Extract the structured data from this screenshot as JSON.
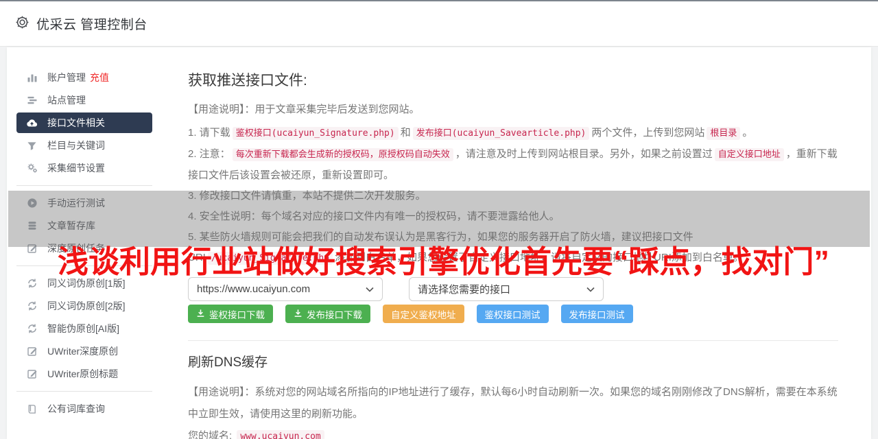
{
  "header": {
    "title": "优采云 管理控制台"
  },
  "sidebar": {
    "items": [
      {
        "label": "账户管理",
        "badge": "充值"
      },
      {
        "label": "站点管理"
      },
      {
        "label": "接口文件相关",
        "active": true
      },
      {
        "label": "栏目与关键词"
      },
      {
        "label": "采集细节设置"
      },
      {
        "label": "手动运行测试"
      },
      {
        "label": "文章暂存库"
      },
      {
        "label": "深度原创任务"
      },
      {
        "label": "同义词伪原创[1版]"
      },
      {
        "label": "同义词伪原创[2版]"
      },
      {
        "label": "智能伪原创[AI版]"
      },
      {
        "label": "UWriter深度原创"
      },
      {
        "label": "UWriter原创标题"
      },
      {
        "label": "公有词库查询"
      }
    ]
  },
  "guide": {
    "title": "获取推送接口文件:",
    "usage": "【用途说明】：用于文章采集完毕后发送到您网站。",
    "item1": {
      "a": "1. 请下载",
      "code1": "鉴权接口(ucaiyun_Signature.php)",
      "b": "和",
      "code2": "发布接口(ucaiyun_Savearticle.php)",
      "c": "两个文件，上传到您网站",
      "code3": "根目录",
      "d": "。"
    },
    "item2": {
      "a": "2. 注意：",
      "hl": "每次重新下载都会生成新的授权码，原授权码自动失效",
      "b": "，请注意及时上传到网站根目录。另外，如果之前设置过",
      "code": "自定义接口地址",
      "c": "，重新下载接口文件后该设置会被还原，重新设置即可。"
    },
    "item3": "3. 修改接口文件请慎重，本站不提供二次开发服务。",
    "item4": "4. 安全性说明：每个域名对应的接口文件内有唯一的授权码，请不要泄露给他人。",
    "item5": {
      "a": "5. 某些防火墙规则可能会把我们的自动发布误认为是黑客行为，如果您的服务器开启了防火墙，建议把接口文件URI",
      "code": "/ucaiyun_Signature.php",
      "b": "添加到白名单，如果您设置了自定义接口地址，请将自定义的接口地址URI添加到白名单。"
    }
  },
  "controls": {
    "site_select": "https://www.ucaiyun.com",
    "api_select": "请选择您需要的接口",
    "btn_auth_download": "鉴权接口下载",
    "btn_publish_download": "发布接口下载",
    "btn_custom_auth": "自定义鉴权地址",
    "btn_auth_test": "鉴权接口测试",
    "btn_publish_test": "发布接口测试"
  },
  "dns": {
    "title": "刷新DNS缓存",
    "usage": "【用途说明】：系统对您的网站域名所指向的IP地址进行了缓存，默认每6小时自动刷新一次。如果您的域名刚刚修改了DNS解析，需要在本系统中立即生效，请使用这里的刷新功能。",
    "domain_label": "您的域名:",
    "domain_value": "www.ucaiyun.com"
  },
  "overlay": {
    "banner_text": "浅谈利用行业站做好搜索引擎优化首先要“踩点，找对门”"
  },
  "colors": {
    "active_nav_bg": "#2e3b52",
    "recharge_red": "#f02b2b",
    "banner_red": "#f11414",
    "code_red": "#c7254e",
    "code_bg": "#f9f2f4",
    "button_green": "#4cb050",
    "button_orange": "#f0ad4e",
    "button_blue": "#55a8f2"
  }
}
